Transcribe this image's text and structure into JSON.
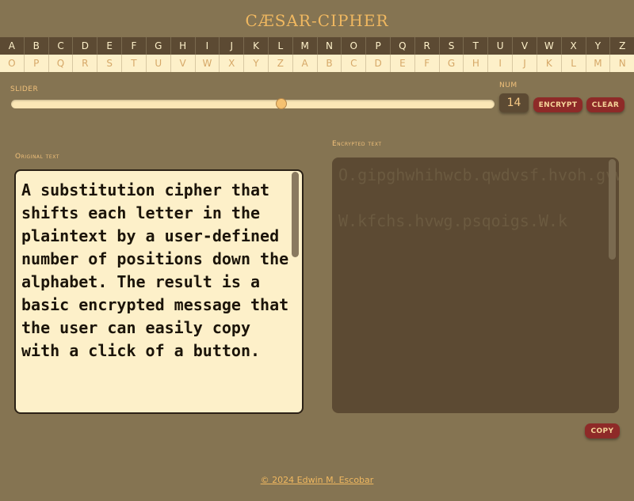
{
  "app": {
    "title": "CÆSAR-CIPHER"
  },
  "alphabet": {
    "plain": [
      "A",
      "B",
      "C",
      "D",
      "E",
      "F",
      "G",
      "H",
      "I",
      "J",
      "K",
      "L",
      "M",
      "N",
      "O",
      "P",
      "Q",
      "R",
      "S",
      "T",
      "U",
      "V",
      "W",
      "X",
      "Y",
      "Z"
    ],
    "shifted": [
      "O",
      "P",
      "Q",
      "R",
      "S",
      "T",
      "U",
      "V",
      "W",
      "X",
      "Y",
      "Z",
      "A",
      "B",
      "C",
      "D",
      "E",
      "F",
      "G",
      "H",
      "I",
      "J",
      "K",
      "L",
      "M",
      "N"
    ]
  },
  "controls": {
    "slider_label": "SLIDER",
    "slider_value": 14,
    "slider_min": 0,
    "slider_max": 25,
    "num_label": "NUM",
    "num_value": "14",
    "encrypt_label": "ENCRYPT",
    "clear_label": "CLEAR",
    "copy_label": "COPY"
  },
  "original": {
    "label": "Original text",
    "text": "A substitution cipher that shifts each letter in the plaintext by a user-defined number of positions down the alphabet. The result is a basic encrypted message that the user can easily copy with a click of a button."
  },
  "encrypted": {
    "label": "Encrypted text",
    "text": "O.gipghwhihwcb.qwdvsf.hvoh.gvwthg.soqv.zshhsf.wb.hvs.dzowbhslh.pm.o.igsf;rstwbsr.biapsf.ct.dcgwhwcbg.rckb.hvs.ozdvopsh<.Hvs.fsgizh.wg.o.pogwq.sbqfmdhsr.asggous.hvoh.hvs.igsf.qob.sogwzm.qcdm.kwhv.o.qzwqy.ct.o.pihhcb<\n\nW.kfchs.hvwg.psqoigs.W.k"
  },
  "footer": {
    "text": "© 2024 Edwin M. Escobar"
  },
  "colors": {
    "background": "#857452",
    "accent": "#f0b860",
    "button": "#8e2a28",
    "panel_dark": "#5c4a33",
    "panel_light": "#fdf0c9"
  }
}
